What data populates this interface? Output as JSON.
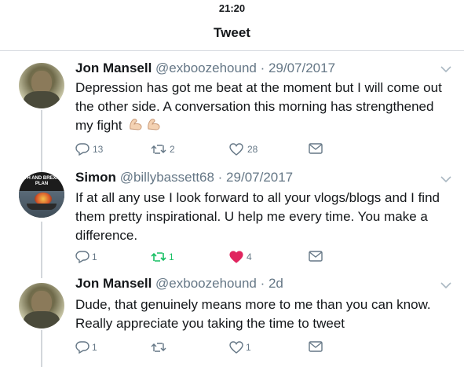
{
  "status_bar": {
    "time": "21:20"
  },
  "nav": {
    "title": "Tweet"
  },
  "colors": {
    "text": "#14171a",
    "muted": "#657786",
    "retweet_active": "#17bf63",
    "like_active": "#e0245e",
    "divider": "#d7dbe0"
  },
  "tweets": [
    {
      "name": "Jon Mansell",
      "meta": "@exboozehound · 29/07/2017",
      "text": "Depression has got me beat at the moment but I will come out the other side. A conversation this morning has strengthened my fight",
      "emoji": [
        "flexed-biceps-icon",
        "flexed-biceps-icon"
      ],
      "replies": "13",
      "retweets": "2",
      "likes": "28",
      "retweeted": false,
      "liked": false
    },
    {
      "name": "Simon",
      "meta": "@billybassett68 · 29/07/2017",
      "avatar_caption": "ITH AND BREXIT PLAN",
      "text": "If at all any use I look forward to all your vlogs/blogs and I find them pretty inspirational. U help me every time. You make a difference.",
      "replies": "1",
      "retweets": "1",
      "likes": "4",
      "retweeted": true,
      "liked": true
    },
    {
      "name": "Jon Mansell",
      "meta": "@exboozehound · 2d",
      "text": "Dude, that genuinely means more to me than you can know. Really appreciate you taking the time to tweet",
      "replies": "1",
      "retweets": "",
      "likes": "1",
      "retweeted": false,
      "liked": false
    }
  ]
}
